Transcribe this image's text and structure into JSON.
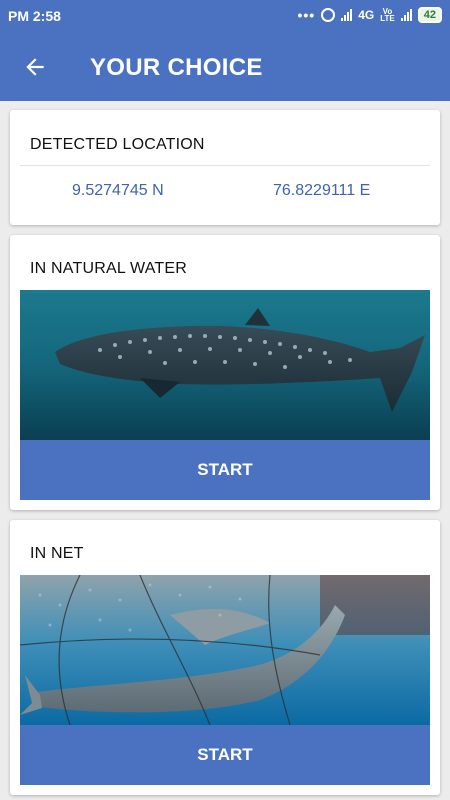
{
  "status_bar": {
    "time": "PM 2:58",
    "network": "4G",
    "volte": [
      "Vo",
      "LTE"
    ],
    "battery": "42"
  },
  "app_bar": {
    "back_icon": "arrow-left-icon",
    "title": "YOUR CHOICE"
  },
  "location_card": {
    "title": "DETECTED LOCATION",
    "latitude": "9.5274745 N",
    "longitude": "76.8229111 E"
  },
  "choices": [
    {
      "title": "IN NATURAL WATER",
      "image": "whale-shark-natural-water",
      "button": "START"
    },
    {
      "title": "IN NET",
      "image": "whale-shark-in-net",
      "button": "START"
    }
  ],
  "colors": {
    "primary": "#4a72c0",
    "coordinate_text": "#3c63b4",
    "background": "#ececec"
  }
}
